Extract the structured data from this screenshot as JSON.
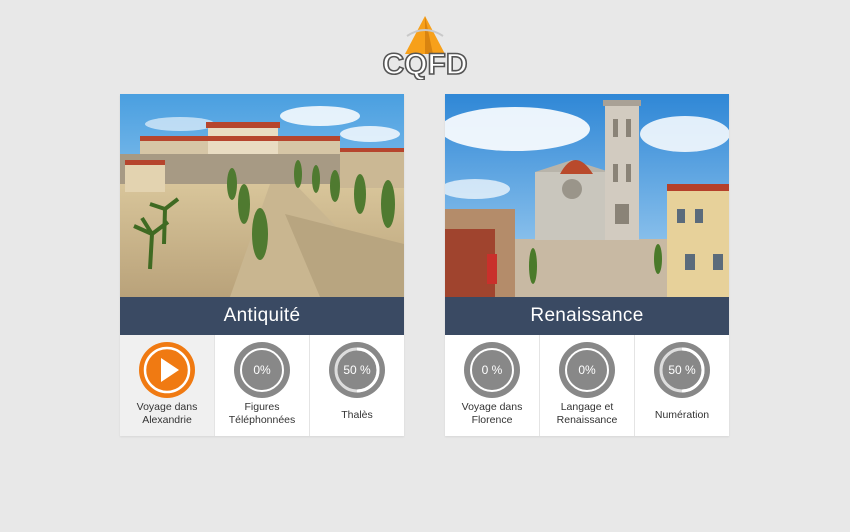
{
  "logo": {
    "text": "CQFD",
    "accent": "#f7a01a"
  },
  "colors": {
    "banner": "#3a4a63",
    "active": "#f07a12",
    "ring": "#888888",
    "ring_track": "#dddddd"
  },
  "cards": [
    {
      "title": "Antiquité",
      "scene_icon": "roman-city-image",
      "items": [
        {
          "line1": "Voyage dans",
          "line2": "Alexandrie",
          "state": "play",
          "icon": "play-icon"
        },
        {
          "line1": "Figures",
          "line2": "Téléphonnées",
          "progress_label": "0%",
          "progress": 0
        },
        {
          "line1": "Thalès",
          "line2": "",
          "progress_label": "50 %",
          "progress": 50
        }
      ]
    },
    {
      "title": "Renaissance",
      "scene_icon": "florence-cathedral-image",
      "items": [
        {
          "line1": "Voyage dans",
          "line2": "Florence",
          "progress_label": "0 %",
          "progress": 0
        },
        {
          "line1": "Langage et",
          "line2": "Renaissance",
          "progress_label": "0%",
          "progress": 0
        },
        {
          "line1": "Numération",
          "line2": "",
          "progress_label": "50 %",
          "progress": 50
        }
      ]
    }
  ]
}
